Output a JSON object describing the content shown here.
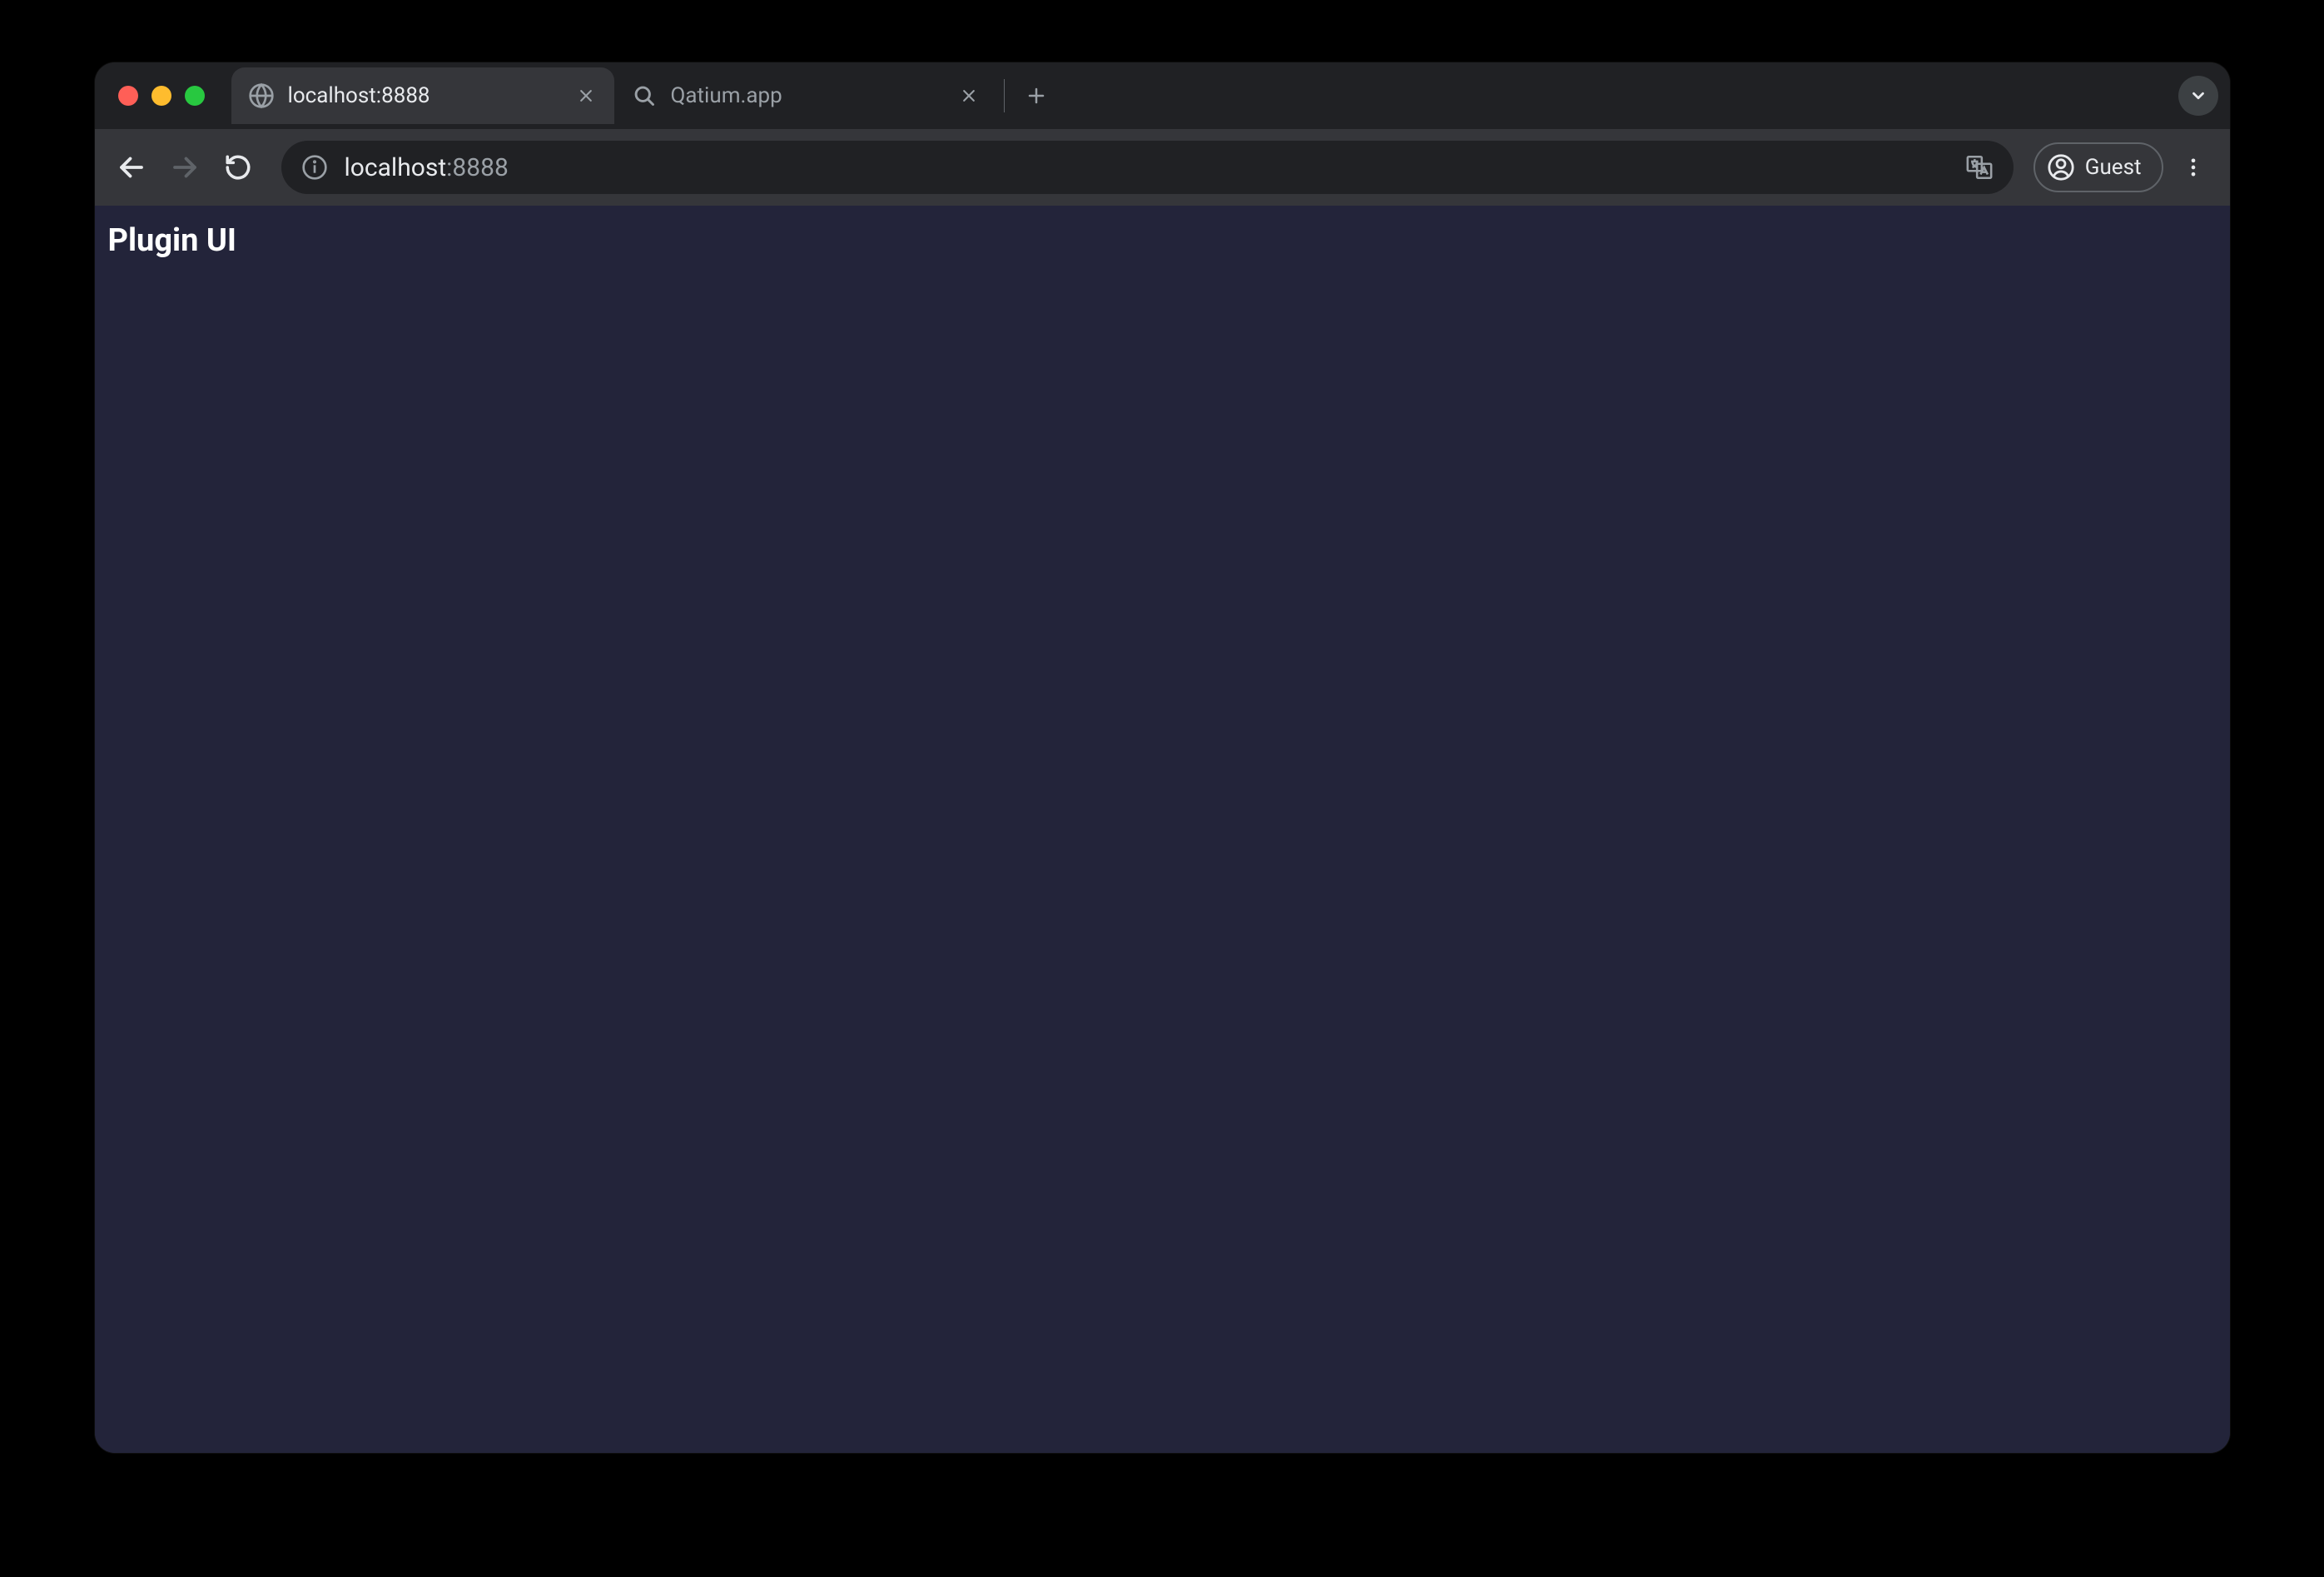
{
  "tabs": [
    {
      "title": "localhost:8888",
      "active": true
    },
    {
      "title": "Qatium.app",
      "active": false
    }
  ],
  "address_bar": {
    "url_host": "localhost",
    "url_port": ":8888"
  },
  "profile": {
    "label": "Guest"
  },
  "page": {
    "heading": "Plugin UI"
  }
}
